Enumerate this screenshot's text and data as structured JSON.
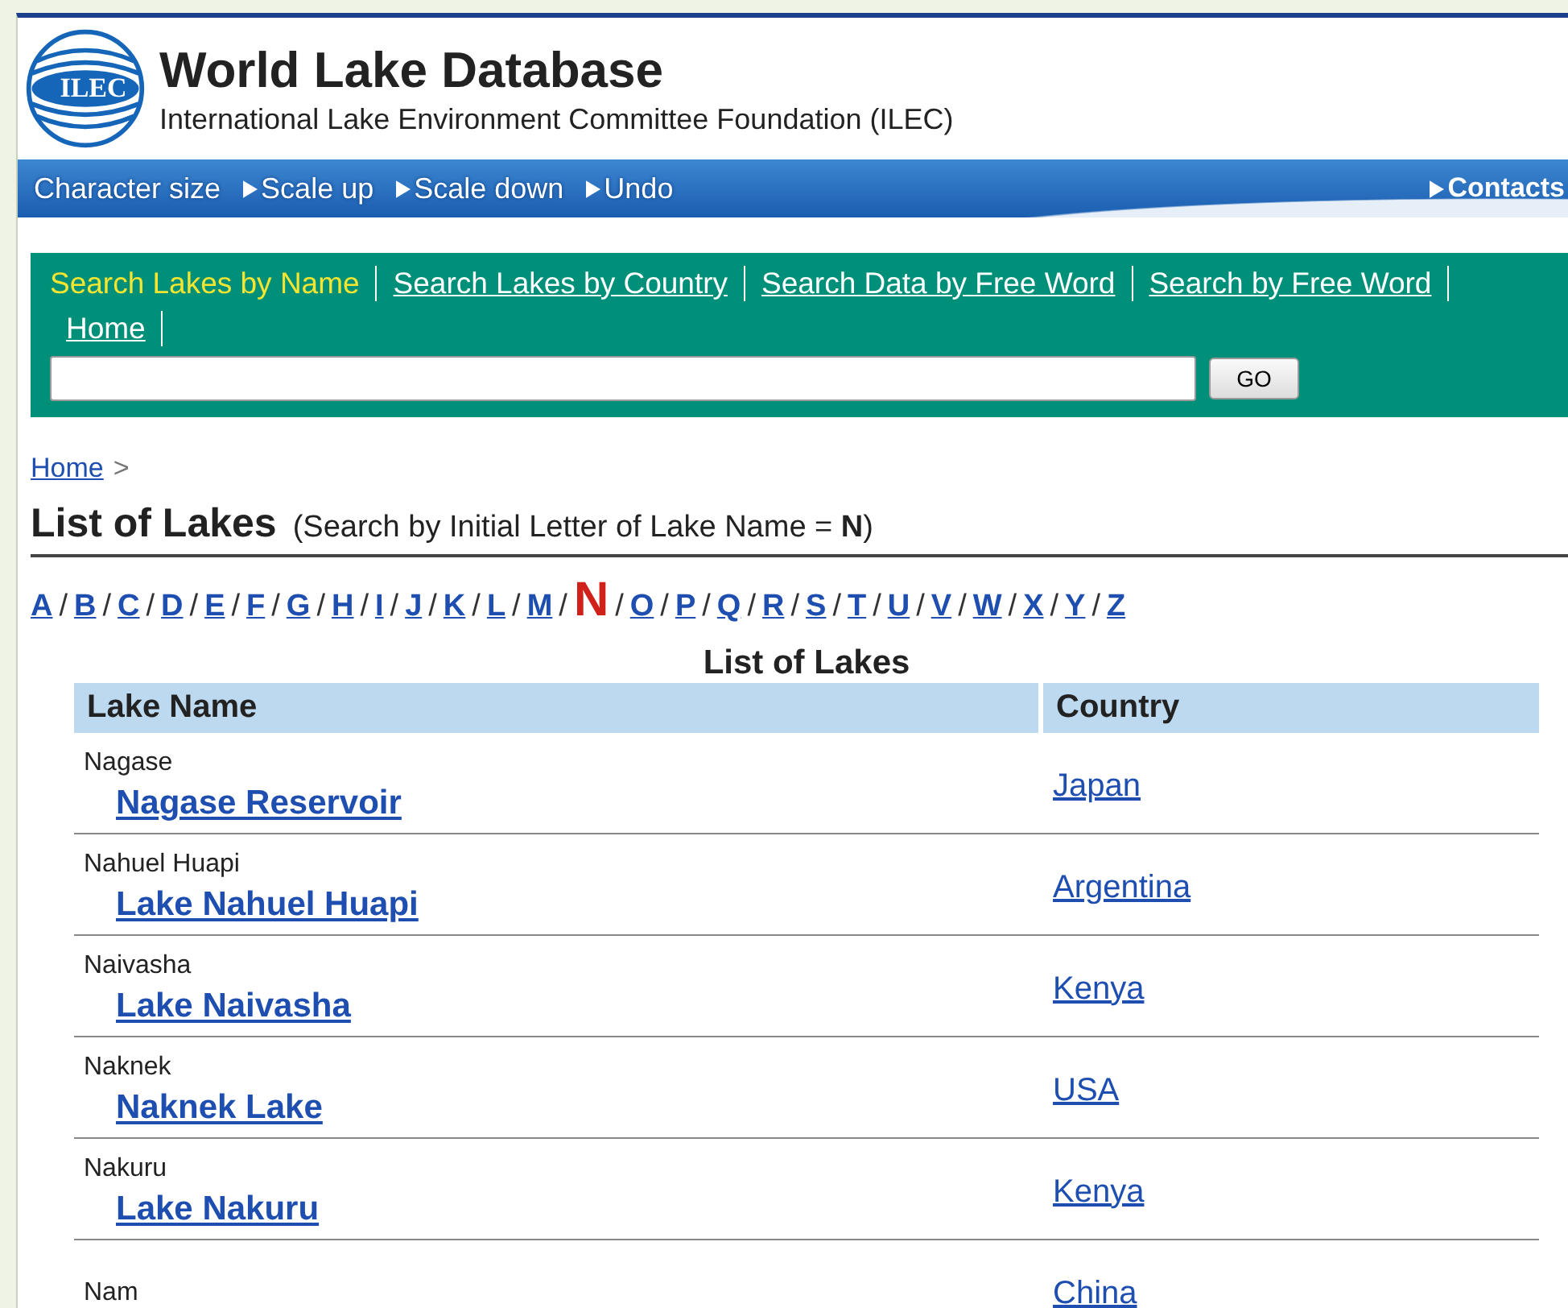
{
  "header": {
    "logo_text": "ILEC",
    "title": "World Lake Database",
    "subtitle": "International Lake Environment Committee Foundation (ILEC)"
  },
  "toolbar": {
    "label": "Character size",
    "links": [
      "Scale up",
      "Scale down",
      "Undo"
    ],
    "contacts": "Contacts"
  },
  "search_tabs": [
    {
      "label": "Search Lakes by Name",
      "selected": true
    },
    {
      "label": "Search Lakes by Country",
      "selected": false
    },
    {
      "label": "Search Data by Free Word",
      "selected": false
    },
    {
      "label": "Search by Free Word",
      "selected": false
    },
    {
      "label": "Home",
      "selected": false
    }
  ],
  "search": {
    "button": "GO"
  },
  "breadcrumb": {
    "link": "Home",
    "separator": ">"
  },
  "page_title": {
    "title": "List of Lakes",
    "note": "(Search by Initial Letter of Lake Name = **N**)"
  },
  "letter_separator": "/",
  "letters": [
    {
      "label": "A",
      "selected": false
    },
    {
      "label": "B",
      "selected": false
    },
    {
      "label": "C",
      "selected": false
    },
    {
      "label": "D",
      "selected": false
    },
    {
      "label": "E",
      "selected": false
    },
    {
      "label": "F",
      "selected": false
    },
    {
      "label": "G",
      "selected": false
    },
    {
      "label": "H",
      "selected": false
    },
    {
      "label": "I",
      "selected": false
    },
    {
      "label": "J",
      "selected": false
    },
    {
      "label": "K",
      "selected": false
    },
    {
      "label": "L",
      "selected": false
    },
    {
      "label": "M",
      "selected": false
    },
    {
      "label": "N",
      "selected": true
    },
    {
      "label": "O",
      "selected": false
    },
    {
      "label": "P",
      "selected": false
    },
    {
      "label": "Q",
      "selected": false
    },
    {
      "label": "R",
      "selected": false
    },
    {
      "label": "S",
      "selected": false
    },
    {
      "label": "T",
      "selected": false
    },
    {
      "label": "U",
      "selected": false
    },
    {
      "label": "V",
      "selected": false
    },
    {
      "label": "W",
      "selected": false
    },
    {
      "label": "X",
      "selected": false
    },
    {
      "label": "Y",
      "selected": false
    },
    {
      "label": "Z",
      "selected": false
    }
  ],
  "table": {
    "caption": "List of Lakes",
    "columns": [
      "Lake Name",
      "Country"
    ],
    "rows": [
      {
        "short": "Nagase",
        "name": "Nagase Reservoir",
        "country": "Japan"
      },
      {
        "short": "Nahuel Huapi",
        "name": "Lake Nahuel Huapi",
        "country": "Argentina"
      },
      {
        "short": "Naivasha",
        "name": "Lake Naivasha",
        "country": "Kenya"
      },
      {
        "short": "Naknek",
        "name": "Naknek Lake",
        "country": "USA"
      },
      {
        "short": "Nakuru",
        "name": "Lake Nakuru",
        "country": "Kenya"
      },
      {
        "short": "Nam",
        "country": "China"
      }
    ]
  }
}
